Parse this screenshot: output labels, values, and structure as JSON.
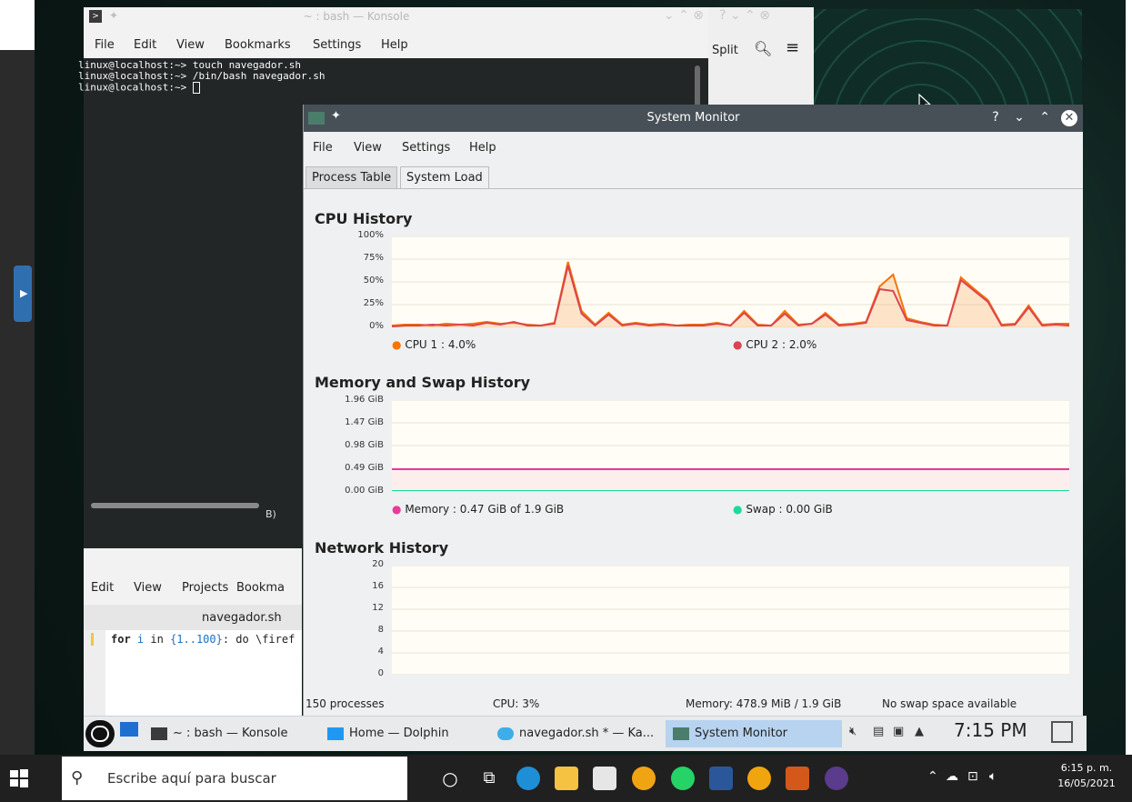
{
  "konsole": {
    "title": "~ : bash — Konsole",
    "menu": [
      "File",
      "Edit",
      "View",
      "Bookmarks",
      "Settings",
      "Help"
    ],
    "lines": [
      "linux@localhost:~> touch navegador.sh",
      "linux@localhost:~> /bin/bash navegador.sh",
      "linux@localhost:~> "
    ],
    "split_label": "Split"
  },
  "kate": {
    "menu": [
      "Edit",
      "View",
      "Projects",
      "Bookma"
    ],
    "tab": "navegador.sh",
    "fragment_b": "B)",
    "code": {
      "kw": "for",
      "var": "i",
      "mid": " in ",
      "range": "{1..100}",
      "rest": ": do \\firef"
    }
  },
  "sysmon": {
    "title": "System Monitor",
    "menu": [
      "File",
      "View",
      "Settings",
      "Help"
    ],
    "tabs": [
      "Process Table",
      "System Load"
    ],
    "active_tab": "System Load",
    "cpu": {
      "title": "CPU History",
      "yticks": [
        "100%",
        "75%",
        "50%",
        "25%",
        "0%"
      ],
      "legend": [
        {
          "label": "CPU 1 : 4.0%",
          "color": "#f67400"
        },
        {
          "label": "CPU 2 : 2.0%",
          "color": "#da4453"
        }
      ]
    },
    "memory": {
      "title": "Memory and Swap History",
      "yticks": [
        "1.96 GiB",
        "1.47 GiB",
        "0.98 GiB",
        "0.49 GiB",
        "0.00 GiB"
      ],
      "legend": [
        {
          "label": "Memory : 0.47 GiB of 1.9 GiB",
          "color": "#e93a9a"
        },
        {
          "label": "Swap : 0.00 GiB",
          "color": "#1cdc9a"
        }
      ]
    },
    "network": {
      "title": "Network History",
      "yticks": [
        "20",
        "16",
        "12",
        "8",
        "4",
        "0"
      ]
    },
    "status": {
      "processes": "150 processes",
      "cpu": "CPU: 3%",
      "memory": "Memory: 478.9 MiB / 1.9 GiB",
      "swap": "No swap space available"
    }
  },
  "plasma_taskbar": {
    "tasks": [
      "~ : bash — Konsole",
      "Home — Dolphin",
      "navegador.sh * — Ka...",
      "System Monitor"
    ],
    "clock": "7:15 PM"
  },
  "windows_taskbar": {
    "search_placeholder": "Escribe aquí para buscar",
    "time": "6:15 p. m.",
    "date": "16/05/2021"
  },
  "colors": {
    "accent": "#3daee9",
    "titlebar": "#475057",
    "taskbar_active": "#b7d3f0"
  },
  "chart_data": [
    {
      "type": "line",
      "title": "CPU History",
      "ylim": [
        0,
        100
      ],
      "x": [
        0,
        2,
        4,
        6,
        8,
        10,
        12,
        14,
        16,
        18,
        20,
        22,
        24,
        26,
        28,
        30,
        32,
        34,
        36,
        38,
        40,
        42,
        44,
        46,
        48,
        50,
        52,
        54,
        56,
        58,
        60,
        62,
        64,
        66,
        68,
        70,
        72,
        74,
        76,
        78,
        80,
        82,
        84,
        86,
        88,
        90,
        92,
        94,
        96,
        98,
        100
      ],
      "series": [
        {
          "name": "CPU 1 : 4.0%",
          "values": [
            2,
            3,
            3,
            2,
            4,
            3,
            4,
            6,
            4,
            5,
            3,
            2,
            5,
            72,
            18,
            3,
            16,
            3,
            5,
            3,
            4,
            2,
            3,
            3,
            5,
            2,
            18,
            3,
            2,
            18,
            3,
            4,
            16,
            3,
            4,
            6,
            45,
            58,
            10,
            6,
            3,
            2,
            55,
            42,
            30,
            3,
            4,
            24,
            3,
            4,
            4
          ]
        },
        {
          "name": "CPU 2 : 2.0%",
          "values": [
            1,
            2,
            2,
            3,
            2,
            3,
            2,
            5,
            3,
            6,
            2,
            2,
            4,
            68,
            15,
            2,
            14,
            2,
            4,
            2,
            3,
            2,
            2,
            2,
            4,
            2,
            16,
            2,
            2,
            15,
            2,
            4,
            14,
            2,
            3,
            5,
            42,
            40,
            8,
            5,
            2,
            2,
            52,
            40,
            28,
            2,
            3,
            22,
            2,
            3,
            2
          ]
        }
      ]
    },
    {
      "type": "line",
      "title": "Memory and Swap History",
      "ylim": [
        0,
        1.96
      ],
      "x": [
        0,
        100
      ],
      "series": [
        {
          "name": "Memory : 0.47 GiB of 1.9 GiB",
          "values": [
            0.47,
            0.47
          ]
        },
        {
          "name": "Swap : 0.00 GiB",
          "values": [
            0.0,
            0.0
          ]
        }
      ]
    },
    {
      "type": "line",
      "title": "Network History",
      "ylim": [
        0,
        20
      ],
      "x": [],
      "series": []
    }
  ]
}
